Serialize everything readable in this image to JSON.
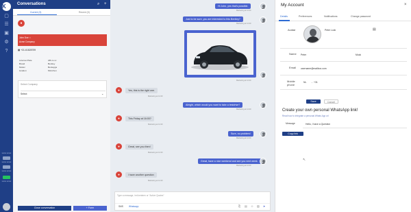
{
  "rail": {
    "logo": "K",
    "stat1": "xxxxx xxxxx",
    "stat2": "xxxxx xxxxx",
    "stat3": "xxxxx xxxxx",
    "stat4": "xxxxx xxxxx"
  },
  "conversations": {
    "title": "Conversations",
    "tabs": [
      "Current (3)",
      "Recent (0)"
    ],
    "contact_name": "John Doe ☆",
    "contact_sub": "Acme Company",
    "phone": "+31-61828759",
    "info": [
      {
        "k": "License Plate",
        "v": "AB-xx-xx"
      },
      {
        "k": "Brand",
        "v": "Bentley"
      },
      {
        "k": "Model",
        "v": "Bentayga"
      },
      {
        "k": "location",
        "v": "München"
      }
    ],
    "select_company": "Select Company",
    "select_placeholder": "Select",
    "close_btn": "Close conversation",
    "form_btn": "+ Form"
  },
  "chat": {
    "messages_right": [
      "Hi John, yes that's possible.",
      "Just to be sure, you are interested to this Bentley?",
      "Allright, which would you want to take a testdrive?",
      "Sure, no problem!",
      "Great, have a nice weekend and see you next week."
    ],
    "messages_left": [
      "Yes, this is the right one.",
      "This Friday at 16:00?",
      "Great, see you then!",
      "I have another question"
    ],
    "meta": "Marketing at 14:20",
    "composer_placeholder": "Type a message, /mt kenteen or \"Active Quotes\"",
    "composer_tabs": [
      "SMS",
      "Whatsapp"
    ]
  },
  "account": {
    "title": "My Account",
    "tabs": [
      "Details",
      "Preferences",
      "Notifications",
      "Change password"
    ],
    "avatar_label": "Avatar",
    "avatar_name": "Peter Lock",
    "name_label": "Name",
    "first_name": "Peter",
    "last_name": "Mock",
    "email_label": "Email",
    "email": "username@mailbox.com",
    "mobile_label": "Mobile phone",
    "mobile_flag": "NL",
    "mobile_code": "+31",
    "save": "Save",
    "cancel": "Cancel",
    "wa_title": "Create your own personal WhatsApp link!",
    "wa_sub": "Read how to integrate a personal Whats App url",
    "message_label": "Message",
    "message_value": "Hello, I have a Question",
    "copy": "Copy link"
  },
  "colors": {
    "brand": "#1f3f86",
    "accent": "#4a63cf",
    "contact": "#d9443a"
  }
}
